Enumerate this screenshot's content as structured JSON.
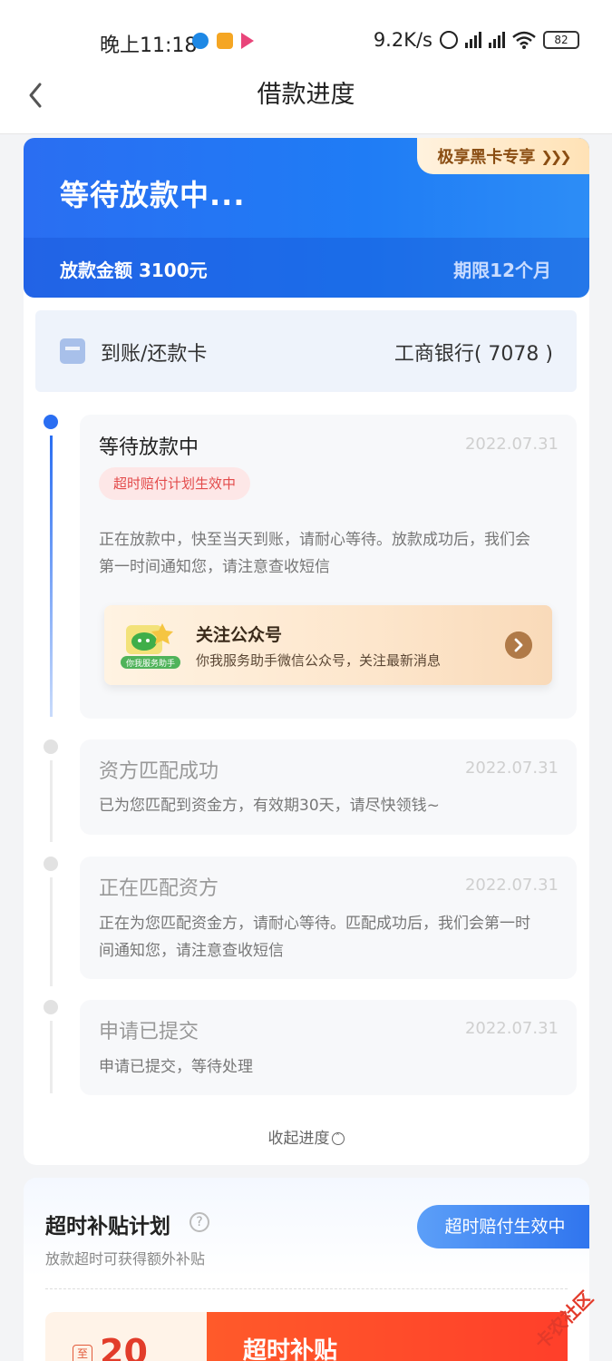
{
  "status_bar": {
    "time": "晚上11:18",
    "network_speed": "9.2K/s",
    "battery": "82"
  },
  "nav": {
    "title": "借款进度"
  },
  "header": {
    "status_title": "等待放款中...",
    "amount_label": "放款金额 3100元",
    "term_label": "期限12个月",
    "vip_tag": "极享黑卡专享"
  },
  "bank": {
    "label": "到账/还款卡",
    "value": "工商银行( 7078 )"
  },
  "timeline": [
    {
      "title": "等待放款中",
      "date": "2022.07.31",
      "badge": "超时赔付计划生效中",
      "desc_line1": "正在放款中，快至当天到账，请耐心等待。放款成功后，我们会",
      "desc_line2": "第一时间通知您，请注意查收短信"
    },
    {
      "title": "资方匹配成功",
      "date": "2022.07.31",
      "desc_line1": "已为您匹配到资金方，有效期30天，请尽快领钱~"
    },
    {
      "title": "正在匹配资方",
      "date": "2022.07.31",
      "desc_line1": "正在为您匹配资金方，请耐心等待。匹配成功后，我们会第一时",
      "desc_line2": "间通知您，请注意查收短信"
    },
    {
      "title": "申请已提交",
      "date": "2022.07.31",
      "desc_line1": "申请已提交，等待处理"
    }
  ],
  "follow_card": {
    "title": "关注公众号",
    "subtitle": "你我服务助手微信公众号，关注最新消息",
    "logo_text": "你我服务助手"
  },
  "collapse_link": "收起进度",
  "subsidy": {
    "title": "超时补贴计划",
    "subtitle": "放款超时可获得额外补贴",
    "status_pill": "超时赔付生效中",
    "coupon_prefix": "至",
    "coupon_amount": "20",
    "coupon_label": "超时补贴"
  },
  "watermark": "卡农社区",
  "colors": {
    "primary_blue": "#2a6ef2",
    "badge_red": "#e34b4b",
    "subsidy_orange": "#ff5a2a"
  }
}
